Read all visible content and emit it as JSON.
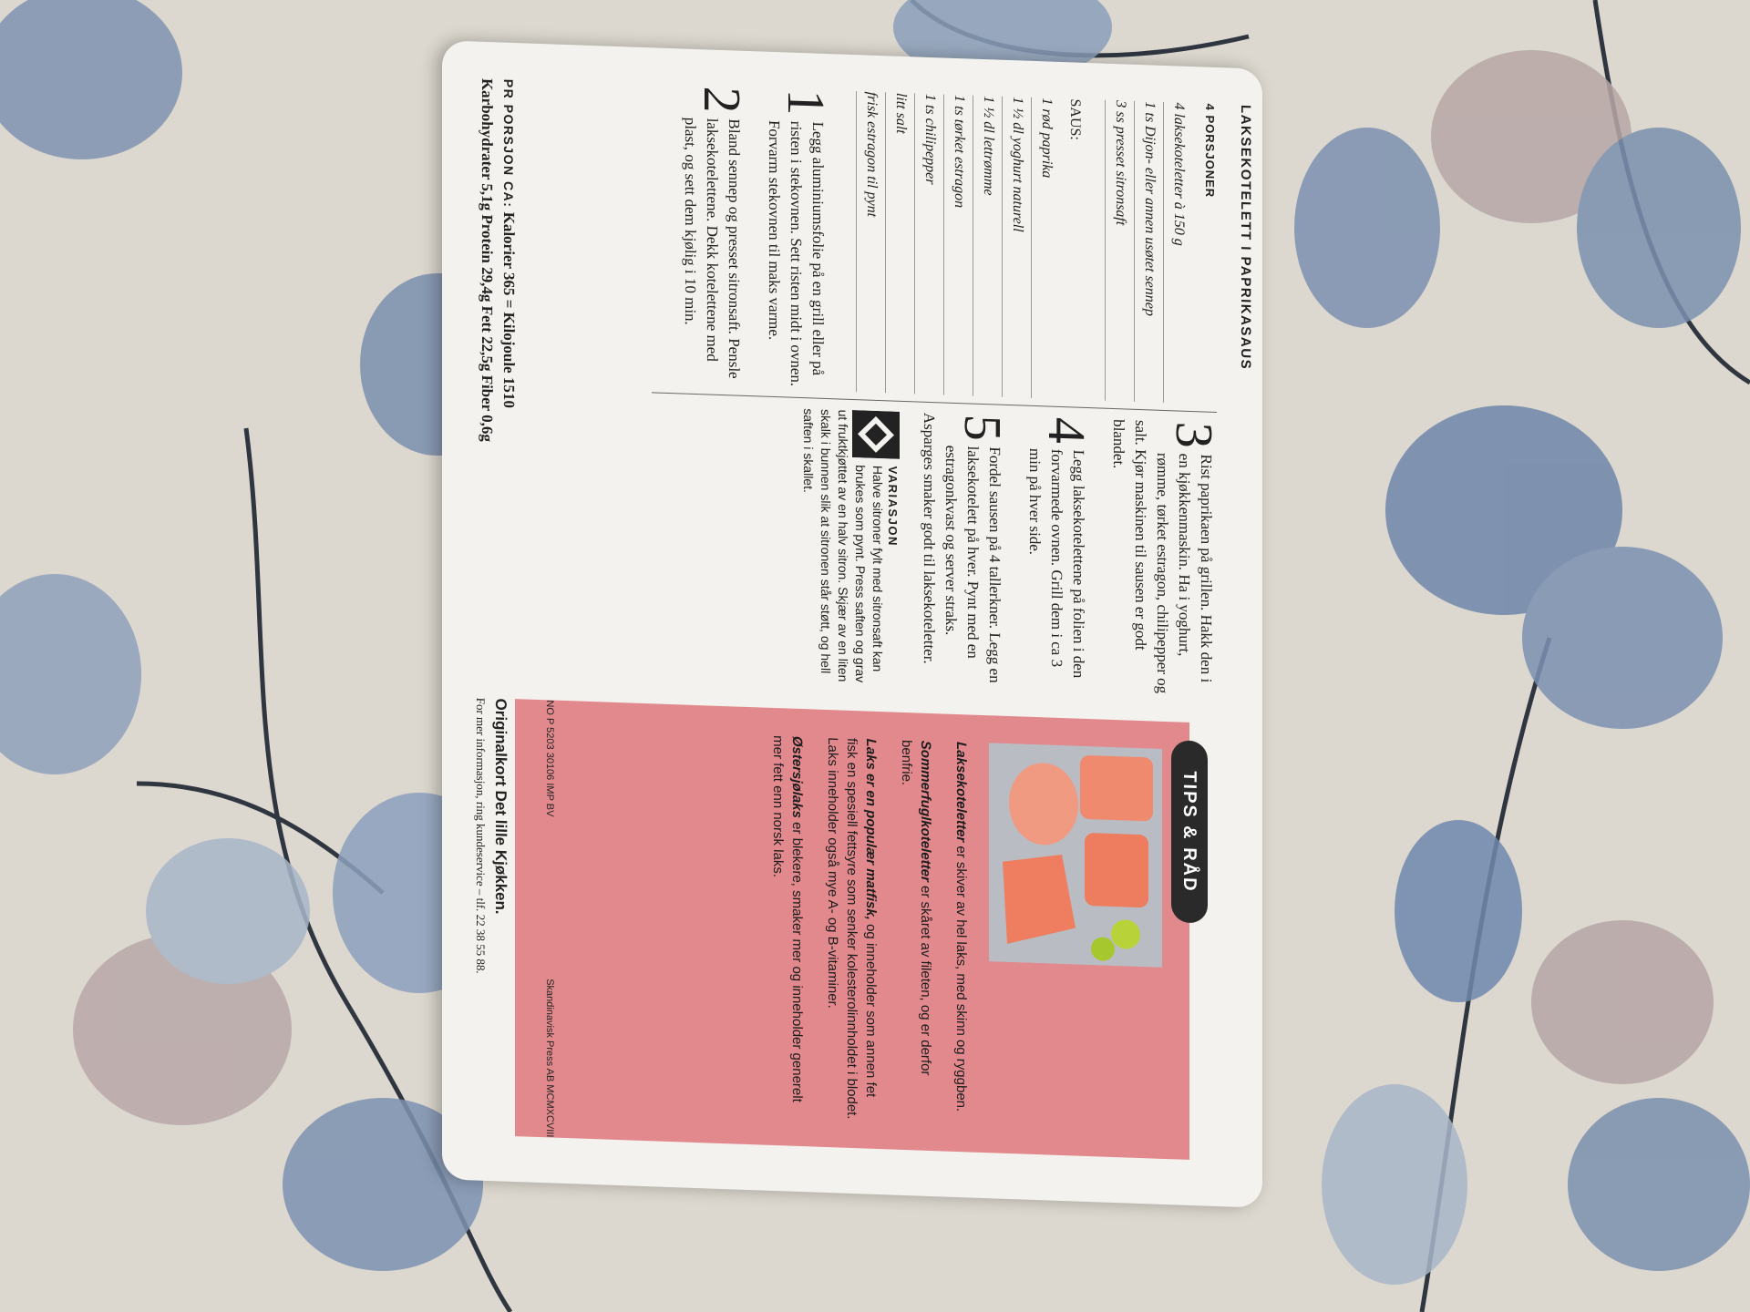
{
  "card": {
    "title": "Laksekotelett i paprikasaus",
    "portions": "4 PORSJONER",
    "ingredients": [
      "4 laksekoteletter à 150 g",
      "1 ts Dijon- eller annen usøtet sennep",
      "3 ss presset sitronsaft"
    ],
    "sauce_heading": "SAUS:",
    "sauce_ingredients": [
      "1 rød paprika",
      "1 ½ dl yoghurt naturell",
      "1 ½ dl lettrømme",
      "1 ts tørket estragon",
      "1 ts chilipepper",
      "litt salt",
      "frisk estragon til pynt"
    ],
    "steps": [
      {
        "num": "1",
        "text": "Legg aluminiumsfolie på en grill eller på risten i stekovnen. Sett risten midt i ovnen. Forvarm stekovnen til maks varme."
      },
      {
        "num": "2",
        "text": "Bland sennep og presset sitronsaft. Pensle laksekotelettene. Dekk kotelettene med plast, og sett dem kjølig i 10 min."
      },
      {
        "num": "3",
        "text": "Rist paprikaen på grillen. Hakk den i en kjøkkenmaskin. Ha i yoghurt, rømme, tørket estragon, chilipepper og salt. Kjør maskinen til sausen er godt blandet."
      },
      {
        "num": "4",
        "text": "Legg laksekotelettene på folien i den forvarmede ovnen. Grill dem i ca 3 min på hver side."
      },
      {
        "num": "5",
        "text": "Fordel sausen på 4 tallerkner. Legg en laksekotelett på hver. Pynt med en estragonkvast og server straks. Asparges smaker godt til laksekoteletter."
      }
    ],
    "variation": {
      "heading": "VARIASJON",
      "text": "Halve sitroner fylt med sitronsaft kan brukes som pynt. Press saften og grav ut fruktkjøttet av en halv sitron. Skjær av en liten skalk i bunnen slik at sitronen står støtt, og hell saften i skallet."
    },
    "nutrition": {
      "label": "PR PORSJON CA:",
      "line1": "Kalorier 365 = Kilojoule 1510",
      "line2": "Karbohydrater 5,1g Protein 29,4g Fett 22,5g Fiber 0,6g"
    },
    "tips": {
      "badge": "TIPS & RÅD",
      "items": [
        {
          "bold": "Laksekoteletter",
          "text": " er skiver av hel laks, med skinn og ryggben."
        },
        {
          "bold": "Sommerfuglkoteletter",
          "text": " er skåret av fileten, og er derfor benfrie."
        },
        {
          "bold": "Laks er en populær matfisk,",
          "text": " og inneholder som annen fet fisk en spesiell fettsyre som senker kolesterolinnholdet i blodet. Laks inneholder også mye A- og B-vitaminer."
        },
        {
          "bold": "Østersjølaks",
          "text": " er blekere, smaker mer og inneholder generelt mer fett enn norsk laks."
        }
      ]
    },
    "footer": {
      "original": "Originalkort Det lille Kjøkken.",
      "info": "For mer informasjon, ring kundeservice – tlf. 22 38 55 88.",
      "codes": "NO P 5203 30106   IMP BV",
      "publisher": "Skandinavisk Press AB  MCMXCVIII"
    }
  }
}
